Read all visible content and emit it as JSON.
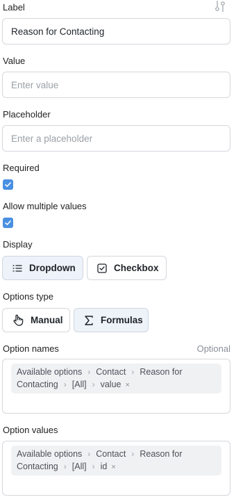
{
  "label_field": {
    "label": "Label",
    "value": "Reason for Contacting"
  },
  "value_field": {
    "label": "Value",
    "placeholder": "Enter value"
  },
  "placeholder_field": {
    "label": "Placeholder",
    "placeholder": "Enter a placeholder"
  },
  "required": {
    "label": "Required",
    "checked": true
  },
  "allow_multiple": {
    "label": "Allow multiple values",
    "checked": true
  },
  "display": {
    "label": "Display",
    "options": [
      {
        "label": "Dropdown",
        "icon": "list-icon",
        "active": true
      },
      {
        "label": "Checkbox",
        "icon": "checkbox-icon",
        "active": false
      }
    ]
  },
  "options_type": {
    "label": "Options type",
    "options": [
      {
        "label": "Manual",
        "icon": "hand-pointer-icon",
        "active": false
      },
      {
        "label": "Formulas",
        "icon": "sigma-icon",
        "active": true
      }
    ]
  },
  "option_names": {
    "label": "Option names",
    "hint": "Optional",
    "path": [
      "Available options",
      "Contact",
      "Reason for Contacting",
      "[All]",
      "value"
    ]
  },
  "option_values": {
    "label": "Option values",
    "path": [
      "Available options",
      "Contact",
      "Reason for Contacting",
      "[All]",
      "id"
    ]
  },
  "colors": {
    "checkbox": "#4a90e2",
    "active_button_bg": "#eef2f9"
  }
}
